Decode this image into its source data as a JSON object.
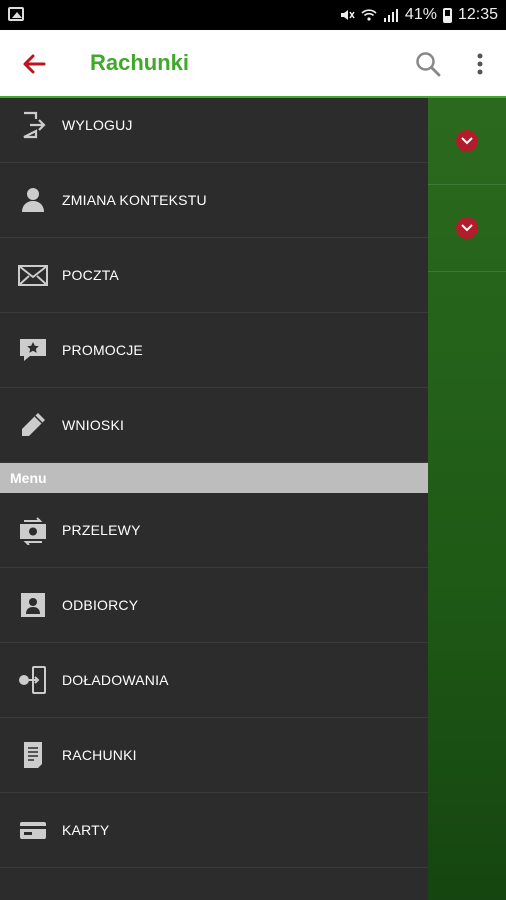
{
  "statusbar": {
    "battery_percent": "41%",
    "time": "12:35"
  },
  "appbar": {
    "title": "Rachunki"
  },
  "drawer": {
    "top_items": [
      {
        "label": "WYLOGUJ",
        "icon": "logout-icon"
      },
      {
        "label": "ZMIANA KONTEKSTU",
        "icon": "user-icon"
      },
      {
        "label": "POCZTA",
        "icon": "mail-icon"
      },
      {
        "label": "PROMOCJE",
        "icon": "promo-icon"
      },
      {
        "label": "WNIOSKI",
        "icon": "pencil-icon"
      }
    ],
    "menu_header": "Menu",
    "menu_items": [
      {
        "label": "PRZELEWY",
        "icon": "transfer-icon"
      },
      {
        "label": "ODBIORCY",
        "icon": "recipient-icon"
      },
      {
        "label": "DOŁADOWANIA",
        "icon": "topup-icon"
      },
      {
        "label": "RACHUNKI",
        "icon": "document-icon"
      },
      {
        "label": "KARTY",
        "icon": "card-icon"
      }
    ]
  },
  "colors": {
    "brand_green": "#3fa92a",
    "accent_red": "#b11d2a",
    "drawer_bg": "#2c2c2c"
  }
}
